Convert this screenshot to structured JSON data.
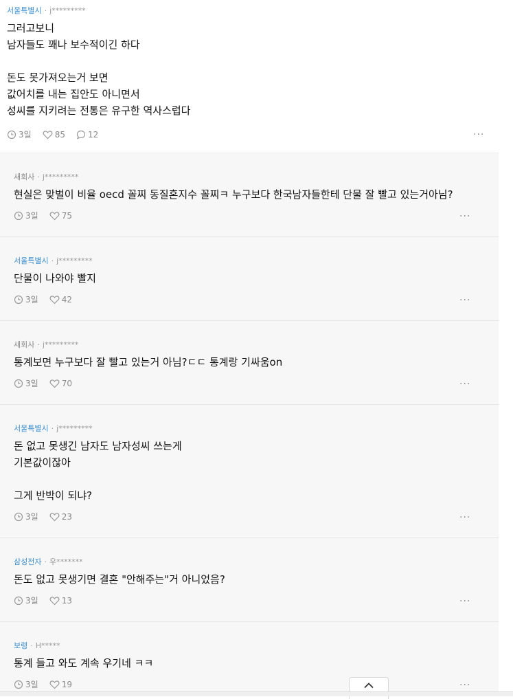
{
  "comments": [
    {
      "location": "서울특별시",
      "user": "j*********",
      "text": "그러고보니\n남자들도 꽤나 보수적이긴 하다\n\n돈도 못가져오는거 보면\n값어치를 내는 집안도 아니면서\n성씨를 지키려는 전통은 유구한 역사스럽다",
      "time": "3일",
      "likes": "85",
      "replies": "12"
    }
  ],
  "replies": [
    {
      "location": "새회사",
      "user": "j*********",
      "text": "현실은 맞벌이 비율 oecd 꼴찌 동질혼지수 꼴찌ㅋ 누구보다 한국남자들한테 단물 잘 빨고 있는거아님?",
      "time": "3일",
      "likes": "75"
    },
    {
      "location": "서울특별시",
      "user": "j*********",
      "text": "단물이 나와야 빨지",
      "time": "3일",
      "likes": "42"
    },
    {
      "location": "새회사",
      "user": "j*********",
      "text": "통계보면 누구보다 잘 빨고 있는거 아님?ㄷㄷ 통계랑 기싸움on",
      "time": "3일",
      "likes": "70"
    },
    {
      "location": "서울특별시",
      "user": "j*********",
      "text": "돈 없고 못생긴 남자도 남자성씨 쓰는게\n기본값이잖아\n\n그게 반박이 되냐?",
      "time": "3일",
      "likes": "23"
    },
    {
      "location": "삼성전자",
      "user": "우*******",
      "text": "돈도 없고 못생기면 결혼 \"안해주는\"거 아니었음?",
      "time": "3일",
      "likes": "13"
    },
    {
      "location": "보령",
      "user": "H*****",
      "text": "통계 들고 와도 계속 우기네 ㅋㅋ",
      "time": "3일",
      "likes": "19"
    }
  ],
  "ui": {
    "more_label": "···",
    "meta_separator": "·",
    "icons": {
      "time": "clock-icon",
      "like": "heart-icon",
      "reply": "speech-bubble-icon",
      "top": "chevron-up-icon"
    },
    "colors": {
      "location": "#3a8ed0",
      "reply_bg": "#f7f7f7"
    }
  }
}
